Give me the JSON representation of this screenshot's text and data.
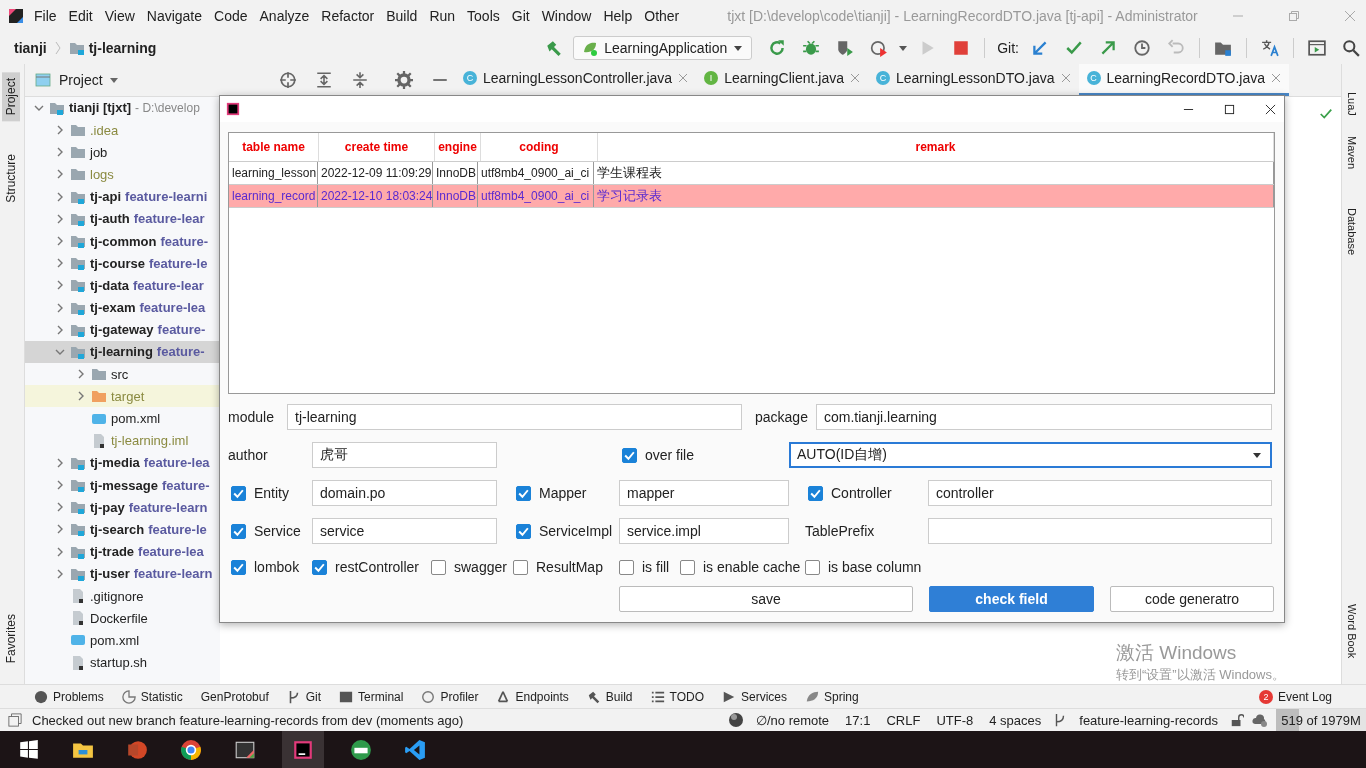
{
  "menu_bar": {
    "items": [
      "File",
      "Edit",
      "View",
      "Navigate",
      "Code",
      "Analyze",
      "Refactor",
      "Build",
      "Run",
      "Tools",
      "Git",
      "Window",
      "Help",
      "Other"
    ]
  },
  "window": {
    "title": "tjxt [D:\\develop\\code\\tianji] - LearningRecordDTO.java [tj-api] - Administrator"
  },
  "nav_bar": {
    "breadcrumbs": [
      "tianji",
      "tj-learning"
    ],
    "run_config": "LearningApplication",
    "git_label": "Git:"
  },
  "left_strip": [
    {
      "label": "Project",
      "selected": true
    },
    {
      "label": "Structure",
      "selected": false
    },
    {
      "label": "Favorites",
      "selected": false
    }
  ],
  "project_panel": {
    "title": "Project",
    "tree": [
      {
        "name": "tianji [tjxt]",
        "branch": "- D:\\develop",
        "kind": "module",
        "expanded": true,
        "ignored": false,
        "selected": false,
        "children": [
          {
            "name": ".idea",
            "kind": "folder",
            "expanded": false,
            "ignored": true,
            "selected": false
          },
          {
            "name": "job",
            "kind": "folder",
            "expanded": false,
            "ignored": false,
            "selected": false
          },
          {
            "name": "logs",
            "kind": "folder",
            "expanded": false,
            "ignored": true,
            "selected": false
          },
          {
            "name": "tj-api",
            "branch": "feature-learni",
            "kind": "module",
            "expanded": false,
            "ignored": false,
            "selected": false
          },
          {
            "name": "tj-auth",
            "branch": "feature-lear",
            "kind": "module",
            "expanded": false,
            "ignored": false,
            "selected": false
          },
          {
            "name": "tj-common",
            "branch": "feature-",
            "kind": "module",
            "expanded": false,
            "ignored": false,
            "selected": false
          },
          {
            "name": "tj-course",
            "branch": "feature-le",
            "kind": "module",
            "expanded": false,
            "ignored": false,
            "selected": false
          },
          {
            "name": "tj-data",
            "branch": "feature-lear",
            "kind": "module",
            "expanded": false,
            "ignored": false,
            "selected": false
          },
          {
            "name": "tj-exam",
            "branch": "feature-lea",
            "kind": "module",
            "expanded": false,
            "ignored": false,
            "selected": false
          },
          {
            "name": "tj-gateway",
            "branch": "feature-",
            "kind": "module",
            "expanded": false,
            "ignored": false,
            "selected": false
          },
          {
            "name": "tj-learning",
            "branch": "feature-",
            "kind": "module",
            "expanded": true,
            "ignored": false,
            "selected": true,
            "children": [
              {
                "name": "src",
                "kind": "folder",
                "expanded": false,
                "ignored": false,
                "selected": false
              },
              {
                "name": "target",
                "kind": "excluded",
                "expanded": false,
                "ignored": true,
                "selected": false
              },
              {
                "name": "pom.xml",
                "kind": "maven",
                "ignored": false,
                "selected": false
              },
              {
                "name": "tj-learning.iml",
                "kind": "iml",
                "ignored": true,
                "selected": false
              }
            ]
          },
          {
            "name": "tj-media",
            "branch": "feature-lea",
            "kind": "module",
            "expanded": false,
            "ignored": false,
            "selected": false
          },
          {
            "name": "tj-message",
            "branch": "feature-",
            "kind": "module",
            "expanded": false,
            "ignored": false,
            "selected": false
          },
          {
            "name": "tj-pay",
            "branch": "feature-learn",
            "kind": "module",
            "expanded": false,
            "ignored": false,
            "selected": false
          },
          {
            "name": "tj-search",
            "branch": "feature-le",
            "kind": "module",
            "expanded": false,
            "ignored": false,
            "selected": false
          },
          {
            "name": "tj-trade",
            "branch": "feature-lea",
            "kind": "module",
            "expanded": false,
            "ignored": false,
            "selected": false
          },
          {
            "name": "tj-user",
            "branch": "feature-learn",
            "kind": "module",
            "expanded": false,
            "ignored": false,
            "selected": false
          },
          {
            "name": ".gitignore",
            "kind": "file",
            "ignored": false,
            "selected": false
          },
          {
            "name": "Dockerfile",
            "kind": "file",
            "ignored": false,
            "selected": false
          },
          {
            "name": "pom.xml",
            "kind": "maven",
            "ignored": false,
            "selected": false
          },
          {
            "name": "startup.sh",
            "kind": "file",
            "ignored": false,
            "selected": false
          }
        ]
      }
    ]
  },
  "editor_tabs": [
    {
      "label": "LearningLessonController.java",
      "letter": "C",
      "kind": "class",
      "selected": false
    },
    {
      "label": "LearningClient.java",
      "letter": "I",
      "kind": "interface",
      "selected": false
    },
    {
      "label": "LearningLessonDTO.java",
      "letter": "C",
      "kind": "class",
      "selected": false
    },
    {
      "label": "LearningRecordDTO.java",
      "letter": "C",
      "kind": "class",
      "selected": true
    }
  ],
  "dialog": {
    "table": {
      "columns": [
        "table name",
        "create time",
        "engine",
        "coding",
        "remark"
      ],
      "rows": [
        {
          "cells": [
            "learning_lesson",
            "2022-12-09 11:09:29",
            "InnoDB",
            "utf8mb4_0900_ai_ci",
            "学生课程表"
          ],
          "selected": false
        },
        {
          "cells": [
            "learning_record",
            "2022-12-10 18:03:24",
            "InnoDB",
            "utf8mb4_0900_ai_ci",
            "学习记录表"
          ],
          "selected": true
        }
      ]
    },
    "module": {
      "label": "module",
      "value": "tj-learning"
    },
    "package": {
      "label": "package",
      "value": "com.tianji.learning"
    },
    "author": {
      "label": "author",
      "value": "虎哥"
    },
    "over_file": {
      "label": "over file",
      "checked": true
    },
    "id_type": {
      "value": "AUTO(ID自增)"
    },
    "layers": [
      {
        "label": "Entity",
        "kind": "check",
        "checked": true,
        "value": "domain.po"
      },
      {
        "label": "Mapper",
        "kind": "check",
        "checked": true,
        "value": "mapper"
      },
      {
        "label": "Controller",
        "kind": "check",
        "checked": true,
        "value": "controller"
      },
      {
        "label": "Service",
        "kind": "check",
        "checked": true,
        "value": "service"
      },
      {
        "label": "ServiceImpl",
        "kind": "check",
        "checked": true,
        "value": "service.impl"
      },
      {
        "label": "TablePrefix",
        "kind": "plain"
      }
    ],
    "options": [
      {
        "label": "lombok",
        "checked": true
      },
      {
        "label": "restController",
        "checked": true
      },
      {
        "label": "swagger",
        "checked": false
      },
      {
        "label": "ResultMap",
        "checked": false
      },
      {
        "label": "is fill",
        "checked": false
      },
      {
        "label": "is enable cache",
        "checked": false
      },
      {
        "label": "is base column",
        "checked": false
      }
    ],
    "buttons": [
      {
        "label": "save",
        "kind": "default"
      },
      {
        "label": "check field",
        "kind": "primary"
      },
      {
        "label": "code generatro",
        "kind": "default"
      }
    ]
  },
  "right_strip": [
    "LuaJ",
    "Maven",
    "Database",
    "Word Book"
  ],
  "activation": {
    "title": "激活 Windows",
    "hint": "转到“设置”以激活 Windows。"
  },
  "tool_windows": [
    "Problems",
    "Statistic",
    "GenProtobuf",
    "Git",
    "Terminal",
    "Profiler",
    "Endpoints",
    "Build",
    "TODO",
    "Services",
    "Spring"
  ],
  "event_log": {
    "label": "Event Log",
    "badge": "2"
  },
  "status_bar": {
    "message": "Checked out new branch feature-learning-records from dev (moments ago)",
    "items": [
      "∅/no remote",
      "17:1",
      "CRLF",
      "UTF-8",
      "4 spaces"
    ],
    "branch": "feature-learning-records",
    "memory": {
      "text": "519 of 1979M",
      "level": 0.26
    }
  }
}
